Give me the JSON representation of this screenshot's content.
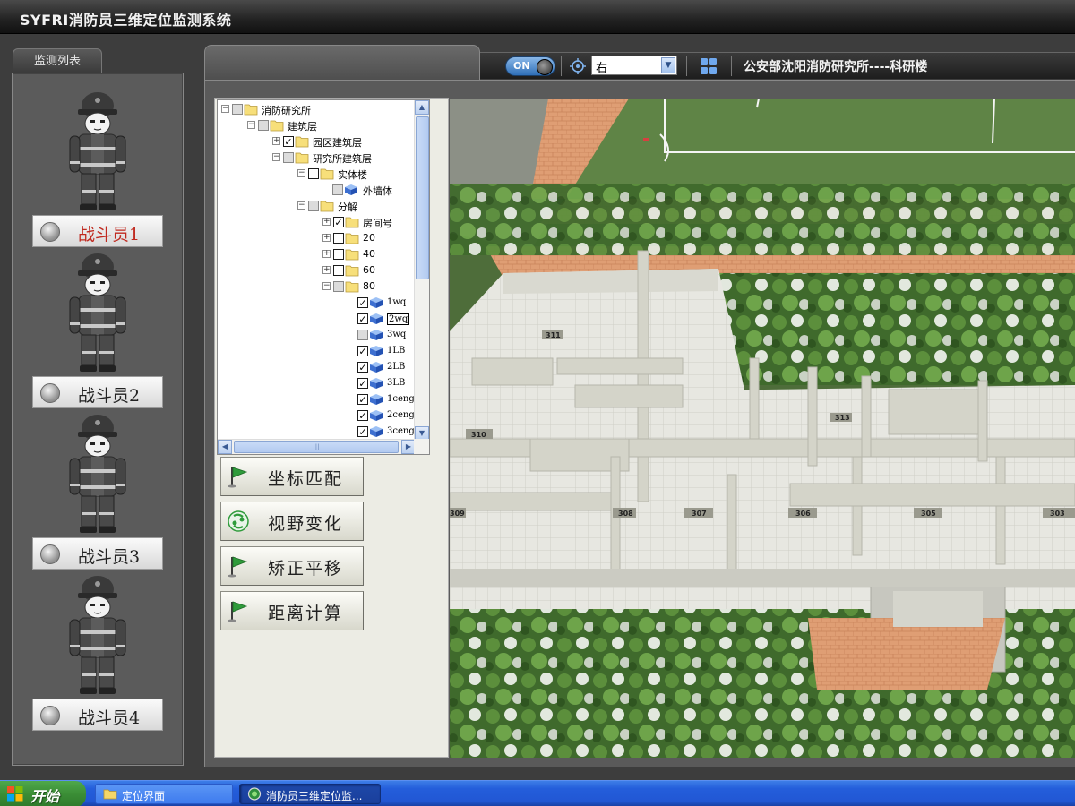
{
  "app": {
    "title": "SYFRI消防员三维定位监测系统"
  },
  "left_panel": {
    "tab_label": "监测列表",
    "firefighters": [
      {
        "label": "战斗员1",
        "active": true
      },
      {
        "label": "战斗员2",
        "active": false
      },
      {
        "label": "战斗员3",
        "active": false
      },
      {
        "label": "战斗员4",
        "active": false
      }
    ]
  },
  "toolbar": {
    "toggle_label": "ON",
    "view_select": {
      "value": "右"
    },
    "org_label": "公安部沈阳消防研究所----科研楼"
  },
  "tree": {
    "items": [
      {
        "label": "消防研究所",
        "check": "part",
        "expander": "-"
      },
      {
        "label": "建筑层",
        "check": "part",
        "expander": "-"
      },
      {
        "label": "园区建筑层",
        "check": "on",
        "expander": "+"
      },
      {
        "label": "研究所建筑层",
        "check": "part",
        "expander": "-"
      },
      {
        "label": "实体楼",
        "check": "off",
        "expander": "-"
      },
      {
        "label": "外墙体",
        "check": "part",
        "expander": ""
      },
      {
        "label": "分解",
        "check": "part",
        "expander": "-"
      },
      {
        "label": "房间号",
        "check": "on",
        "expander": "+"
      },
      {
        "label": "20",
        "check": "off",
        "expander": "+"
      },
      {
        "label": "40",
        "check": "off",
        "expander": "+"
      },
      {
        "label": "60",
        "check": "off",
        "expander": "+"
      },
      {
        "label": "80",
        "check": "part",
        "expander": "-"
      },
      {
        "label": "1wq",
        "check": "on",
        "expander": ""
      },
      {
        "label": "2wq",
        "check": "on",
        "expander": "",
        "selected": true
      },
      {
        "label": "3wq",
        "check": "part",
        "expander": ""
      },
      {
        "label": "1LB",
        "check": "on",
        "expander": ""
      },
      {
        "label": "2LB",
        "check": "on",
        "expander": ""
      },
      {
        "label": "3LB",
        "check": "on",
        "expander": ""
      },
      {
        "label": "1ceng",
        "check": "on",
        "expander": ""
      },
      {
        "label": "2ceng",
        "check": "on",
        "expander": ""
      },
      {
        "label": "3ceng",
        "check": "on",
        "expander": ""
      }
    ]
  },
  "actions": [
    {
      "label": "坐标匹配",
      "icon": "green-flag-icon"
    },
    {
      "label": "视野变化",
      "icon": "view-rotate-icon"
    },
    {
      "label": "矫正平移",
      "icon": "green-flag-icon"
    },
    {
      "label": "距离计算",
      "icon": "green-flag-icon"
    }
  ],
  "scene": {
    "room_labels": [
      "311",
      "310",
      "309",
      "308",
      "307",
      "306",
      "305",
      "303",
      "313"
    ]
  },
  "taskbar": {
    "start_label": "开始",
    "tasks": [
      {
        "label": "定位界面",
        "icon": "folder-icon"
      },
      {
        "label": "消防员三维定位监...",
        "icon": "app-icon"
      }
    ]
  },
  "colors": {
    "accent_red": "#c0291f",
    "taskbar_blue": "#245edb",
    "start_green": "#3b8e36"
  }
}
